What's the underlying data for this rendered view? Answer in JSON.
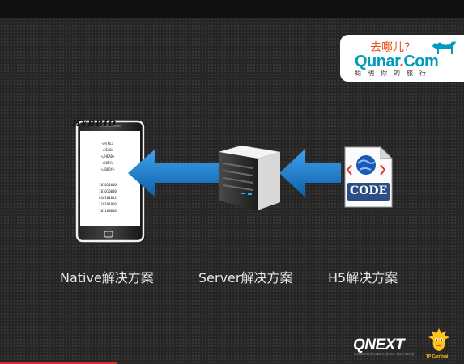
{
  "logo": {
    "cn_slogan": "去哪儿?",
    "brand_prefix": "Qunar",
    "brand_dot": ".",
    "brand_suffix": "Com",
    "tagline": "聪明你的旅行",
    "color_teal": "#009cbd",
    "color_orange": "#e8501e"
  },
  "diagram": {
    "phone": {
      "title": "HYBRID",
      "code_lines": [
        "<HTML>",
        "<HEAD>",
        "</HEAD>",
        "<BODY>",
        "</BODY>"
      ],
      "binary_lines": [
        "101011010",
        "101010000",
        "010101011",
        "110101010",
        "101100010"
      ]
    },
    "code_file_label": "CODE",
    "captions": {
      "native": "Native解决方案",
      "server": "Server解决方案",
      "h5": "H5解决方案"
    },
    "arrow_color": "#1a7fd0",
    "arrow_direction": "right-to-left"
  },
  "footer": {
    "brand": "QNEXT",
    "brand_sub": "QUNAR FRONT-END & MOBILE TECH SALON",
    "mascot_label": "TP Carnival"
  }
}
